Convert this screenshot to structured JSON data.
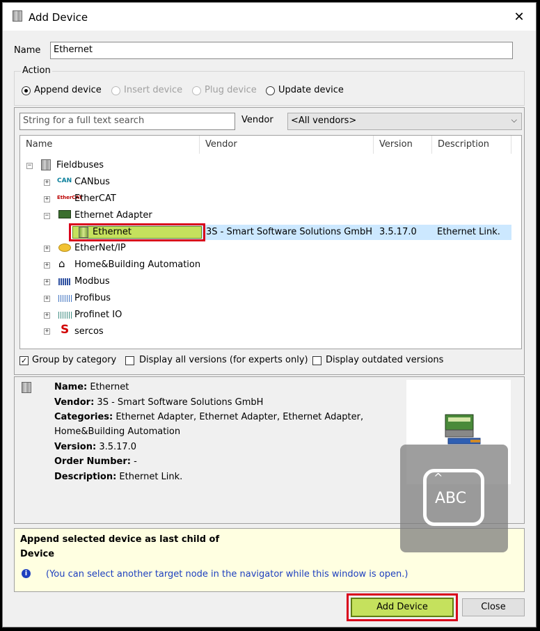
{
  "window": {
    "title": "Add Device",
    "close_glyph": "✕"
  },
  "name_field": {
    "label": "Name",
    "value": "Ethernet"
  },
  "action": {
    "label": "Action",
    "options": [
      {
        "label": "Append device",
        "selected": true,
        "enabled": true
      },
      {
        "label": "Insert device",
        "selected": false,
        "enabled": false
      },
      {
        "label": "Plug device",
        "selected": false,
        "enabled": false
      },
      {
        "label": "Update device",
        "selected": false,
        "enabled": true
      }
    ]
  },
  "search": {
    "placeholder": "String for a full text search",
    "vendor_label": "Vendor",
    "vendor_value": "<All vendors>"
  },
  "tree": {
    "columns": [
      "Name",
      "Vendor",
      "Version",
      "Description"
    ],
    "root": "Fieldbuses",
    "items": [
      {
        "label": "CANbus",
        "icon": "canbus-icon"
      },
      {
        "label": "EtherCAT",
        "icon": "ethercat-icon"
      },
      {
        "label": "Ethernet Adapter",
        "icon": "ethernet-adapter-icon"
      },
      {
        "label": "Ethernet",
        "vendor": "3S - Smart Software Solutions GmbH",
        "version": "3.5.17.0",
        "description": "Ethernet Link."
      },
      {
        "label": "EtherNet/IP",
        "icon": "ethernetip-icon"
      },
      {
        "label": "Home&Building Automation",
        "icon": "home-icon"
      },
      {
        "label": "Modbus",
        "icon": "modbus-icon"
      },
      {
        "label": "Profibus",
        "icon": "profibus-icon"
      },
      {
        "label": "Profinet IO",
        "icon": "profinet-icon"
      },
      {
        "label": "sercos",
        "icon": "sercos-icon"
      }
    ]
  },
  "options": {
    "group_by_category": {
      "label": "Group by category",
      "checked": true
    },
    "display_all_versions": {
      "label": "Display all versions (for experts only)",
      "checked": false
    },
    "display_outdated": {
      "label": "Display outdated versions",
      "checked": false
    }
  },
  "info": {
    "name_label": "Name:",
    "name_value": "Ethernet",
    "vendor_label": "Vendor:",
    "vendor_value": "3S - Smart Software Solutions GmbH",
    "categories_label": "Categories:",
    "categories_value": "Ethernet Adapter, Ethernet Adapter, Ethernet Adapter,",
    "categories_value2": "Home&Building Automation",
    "version_label": "Version:",
    "version_value": "3.5.17.0",
    "order_label": "Order Number:",
    "order_value": "-",
    "desc_label": "Description:",
    "desc_value": "Ethernet Link."
  },
  "hint": {
    "line1": "Append selected device as last child of",
    "line2": "Device",
    "note": "(You can select another target node in the navigator while this window is open.)"
  },
  "overlay": {
    "text": "ABC"
  },
  "buttons": {
    "add": "Add Device",
    "close": "Close"
  },
  "colors": {
    "selected_row": "#cce8ff",
    "highlight_green": "#c5e15d",
    "red_outline": "#d9001b",
    "hint_bg": "#ffffe1"
  }
}
